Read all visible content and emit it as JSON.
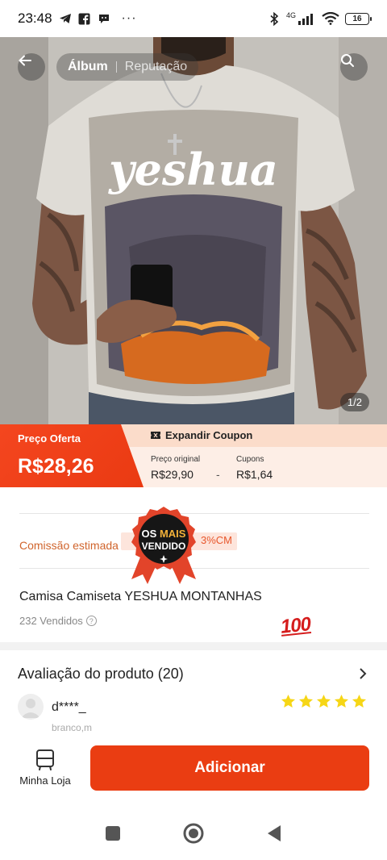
{
  "status_bar": {
    "time": "23:48",
    "more": "···",
    "network": "4G",
    "battery": "16"
  },
  "hero": {
    "tabs": [
      {
        "label": "Álbum",
        "active": true
      },
      {
        "label": "Reputação",
        "active": false
      }
    ],
    "counter": "1/2",
    "shirt_print": "yeshua"
  },
  "price": {
    "offer_label": "Preço Oferta",
    "offer_value": "R$28,26",
    "coupon_label": "Expandir Coupon",
    "original_label": "Preço original",
    "original_value": "R$29,90",
    "separator": "-",
    "coupons_label": "Cupons",
    "coupons_value": "R$1,64"
  },
  "commission": {
    "label": "Comissão estimada",
    "value": "3%CM"
  },
  "seal": {
    "line1": "OS",
    "line1b": "MAIS",
    "line2": "VENDIDO"
  },
  "product": {
    "title": "Camisa Camiseta YESHUA MONTANHAS",
    "sold": "232 Vendidos",
    "emoji_label": "100"
  },
  "reviews": {
    "title": "Avaliação do produto (20)",
    "reviewer_name": "d****_",
    "reviewer_variant": "branco,m",
    "rating": 5
  },
  "bottom_bar": {
    "store_label": "Minha Loja",
    "add_label": "Adicionar"
  },
  "colors": {
    "accent": "#ea3d12",
    "price_bg": "#fdeee6",
    "star": "#f6d616"
  }
}
